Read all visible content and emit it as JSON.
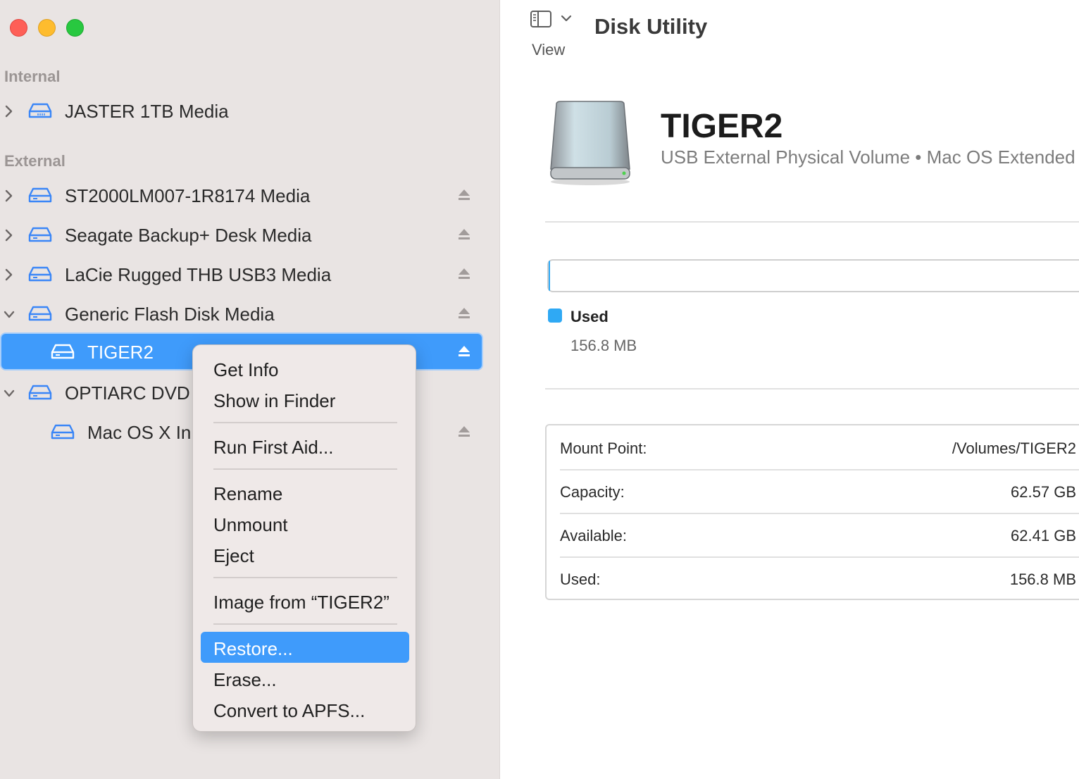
{
  "window": {
    "title": "Disk Utility"
  },
  "toolbar": {
    "view_label": "View",
    "sidebar_icon": "sidebar-icon"
  },
  "sidebar": {
    "sections": {
      "internal": "Internal",
      "external": "External"
    },
    "items": [
      {
        "label": "JASTER 1TB Media",
        "icon": "internal-drive-icon",
        "expanded": false
      },
      {
        "label": "ST2000LM007-1R8174 Media",
        "icon": "external-drive-icon",
        "expanded": false,
        "ejectable": true
      },
      {
        "label": "Seagate Backup+ Desk Media",
        "icon": "external-drive-icon",
        "expanded": false,
        "ejectable": true
      },
      {
        "label": "LaCie Rugged THB USB3 Media",
        "icon": "external-drive-icon",
        "expanded": false,
        "ejectable": true
      },
      {
        "label": "Generic Flash Disk Media",
        "icon": "external-drive-icon",
        "expanded": true,
        "ejectable": true
      },
      {
        "label": "TIGER2",
        "icon": "external-drive-icon",
        "selected": true,
        "ejectable": true
      },
      {
        "label": "OPTIARC DVD",
        "icon": "external-drive-icon",
        "expanded": true
      },
      {
        "label": "Mac OS X In",
        "icon": "external-drive-icon",
        "ejectable": true
      }
    ]
  },
  "context_menu": {
    "items": [
      "Get Info",
      "Show in Finder",
      "Run First Aid...",
      "Rename",
      "Unmount",
      "Eject",
      "Image from “TIGER2”",
      "Restore...",
      "Erase...",
      "Convert to APFS..."
    ],
    "highlighted": "Restore..."
  },
  "volume": {
    "name": "TIGER2",
    "description": "USB External Physical Volume • Mac OS Extended",
    "usage": {
      "label": "Used",
      "value": "156.8 MB",
      "fraction": 0.0025,
      "color": "#2fa9f4"
    }
  },
  "info": [
    {
      "key": "Mount Point:",
      "value": "/Volumes/TIGER2"
    },
    {
      "key": "Capacity:",
      "value": "62.57 GB"
    },
    {
      "key": "Available:",
      "value": "62.41 GB"
    },
    {
      "key": "Used:",
      "value": "156.8 MB"
    }
  ],
  "colors": {
    "accent": "#3f9bfb",
    "sidebar_bg": "#e9e4e3",
    "drive_icon": "#3a86f7"
  }
}
